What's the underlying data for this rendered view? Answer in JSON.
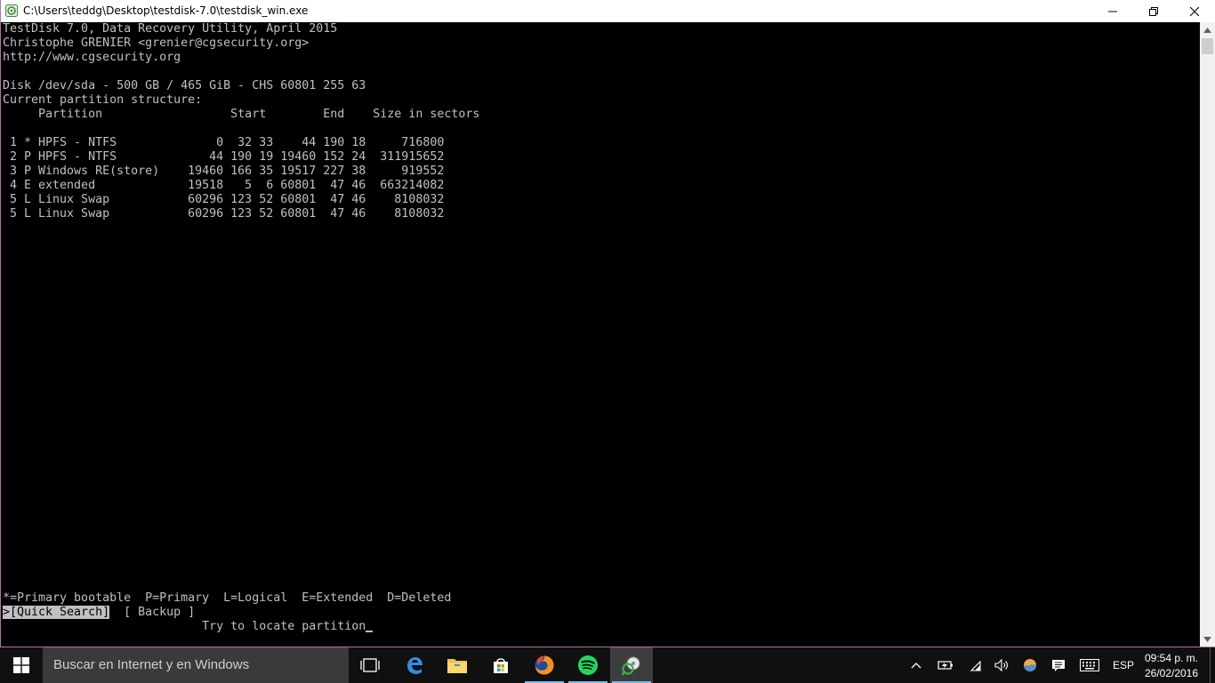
{
  "window": {
    "title": "C:\\Users\\teddg\\Desktop\\testdisk-7.0\\testdisk_win.exe"
  },
  "console": {
    "line1": "TestDisk 7.0, Data Recovery Utility, April 2015",
    "line2": "Christophe GRENIER <grenier@cgsecurity.org>",
    "line3": "http://www.cgsecurity.org",
    "line5": "Disk /dev/sda - 500 GB / 465 GiB - CHS 60801 255 63",
    "line6": "Current partition structure:",
    "header": "     Partition                  Start        End    Size in sectors",
    "rows": [
      " 1 * HPFS - NTFS              0  32 33    44 190 18     716800",
      " 2 P HPFS - NTFS             44 190 19 19460 152 24  311915652",
      " 3 P Windows RE(store)    19460 166 35 19517 227 38     919552",
      " 4 E extended             19518   5  6 60801  47 46  663214082",
      " 5 L Linux Swap           60296 123 52 60801  47 46    8108032",
      " 5 L Linux Swap           60296 123 52 60801  47 46    8108032"
    ],
    "legend": "*=Primary bootable  P=Primary  L=Logical  E=Extended  D=Deleted",
    "menu": {
      "quick_search": ">[Quick Search]",
      "backup": "  [ Backup ]"
    },
    "status": "                            Try to locate partition"
  },
  "taskbar": {
    "search_placeholder": "Buscar en Internet y en Windows",
    "language": "ESP",
    "time": "09:54 p. m.",
    "date": "26/02/2016"
  },
  "colors": {
    "console_bg": "#000000",
    "console_fg": "#c0c0c0",
    "window_border": "#b06fb0",
    "taskbar_bg": "#101010",
    "accent": "#76b9ed"
  }
}
